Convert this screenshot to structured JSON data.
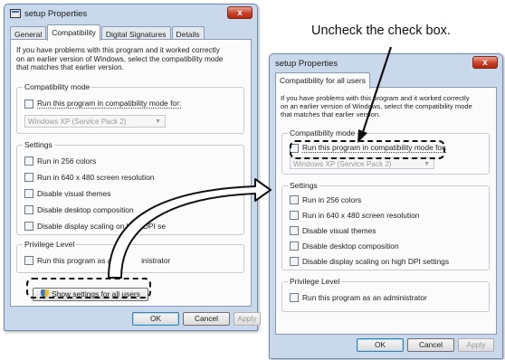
{
  "callout": {
    "text": "Uncheck the check box."
  },
  "window1": {
    "title": "setup Properties",
    "close": "x",
    "tabs": [
      "General",
      "Compatibility",
      "Digital Signatures",
      "Details"
    ],
    "active_tab": "Compatibility",
    "description_lines": [
      "If you have problems with this program and it worked correctly",
      "on an earlier version of Windows, select the compatibility mode",
      "that matches that earlier version."
    ],
    "compat_group": "Compatibility mode",
    "compat_checkbox": "Run this program in compatibility mode for:",
    "os_select": "Windows XP (Service Pack 2)",
    "settings_group": "Settings",
    "settings": [
      "Run in 256 colors",
      "Run in 640 x 480 screen resolution",
      "Disable visual themes",
      "Disable desktop composition",
      "Disable display scaling on high DPI se"
    ],
    "privilege_group": "Privilege Level",
    "privilege_checkbox_start": "Run this program as an",
    "privilege_checkbox_end": "inistrator",
    "show_all_button": "Show settings for all users",
    "ok": "OK",
    "cancel": "Cancel",
    "apply": "Apply"
  },
  "window2": {
    "title": "setup Properties",
    "close": "x",
    "tab": "Compatibility for all users",
    "description_lines": [
      "If you have problems with this program and it worked correctly",
      "on an earlier version of Windows, select the compatibility mode",
      "that matches that earlier version."
    ],
    "compat_group": "Compatibility mode",
    "compat_checkbox": "Run this program in compatibility mode for:",
    "os_select": "Windows XP (Service Pack 2)",
    "settings_group": "Settings",
    "settings": [
      "Run in 256 colors",
      "Run in 640 x 480 screen resolution",
      "Disable visual themes",
      "Disable desktop composition",
      "Disable display scaling on high DPI settings"
    ],
    "privilege_group": "Privilege Level",
    "privilege_checkbox": "Run this program as an administrator",
    "ok": "OK",
    "cancel": "Cancel",
    "apply": "Apply"
  }
}
